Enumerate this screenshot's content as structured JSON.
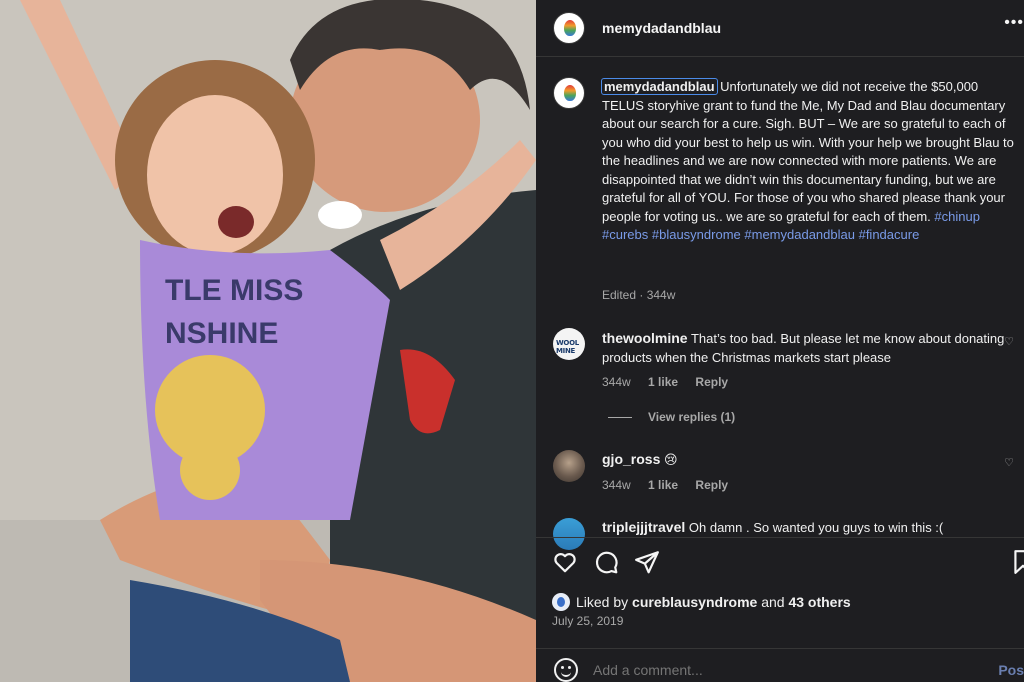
{
  "post": {
    "username": "memydadandblau",
    "more_icon": "•••",
    "caption_text": "Unfortunately we did not receive the $50,000 TELUS storyhive grant to fund the Me, My Dad and Blau documentary about our search for a cure. Sigh. BUT – We are so grateful to each of you who did your best to help us win. With your help we brought Blau to the headlines and we are now connected with more patients. We are disappointed that we didn’t win this documentary funding, but we are grateful for all of YOU. For those of you who shared please thank your people for voting us.. we are so grateful for each of them.",
    "hashtags": [
      "#chinup",
      "#curebs",
      "#blausyndrome",
      "#memydadandblau",
      "#findacure"
    ],
    "caption_meta": "Edited · 344w"
  },
  "comments": [
    {
      "username": "thewoolmine",
      "avatar_text": "WOOL MINE",
      "text": "That’s too bad. But please let me know about donating products when the Christmas markets start please",
      "time": "344w",
      "likes": "1 like",
      "reply": "Reply",
      "view_replies": "View replies (1)"
    },
    {
      "username": "gjo_ross",
      "text": "😢",
      "time": "344w",
      "likes": "1 like",
      "reply": "Reply"
    },
    {
      "username": "triplejjjtravel",
      "text": "Oh damn . So wanted you guys to win this :("
    }
  ],
  "likes": {
    "prefix": "Liked by",
    "user": "cureblausyndrome",
    "connector": "and",
    "others": "43 others"
  },
  "date": "July 25, 2019",
  "add_comment": {
    "placeholder": "Add a comment...",
    "post_label": "Pos"
  },
  "icons": {
    "like": "heart-icon",
    "comment": "comment-icon",
    "share": "share-icon",
    "save": "bookmark-icon",
    "emoji": "emoji-icon"
  },
  "colors": {
    "panel_bg": "#1e1e21",
    "hashtag": "#7a9be8",
    "muted": "#a8a8a8",
    "highlight": "#4b8be8"
  }
}
